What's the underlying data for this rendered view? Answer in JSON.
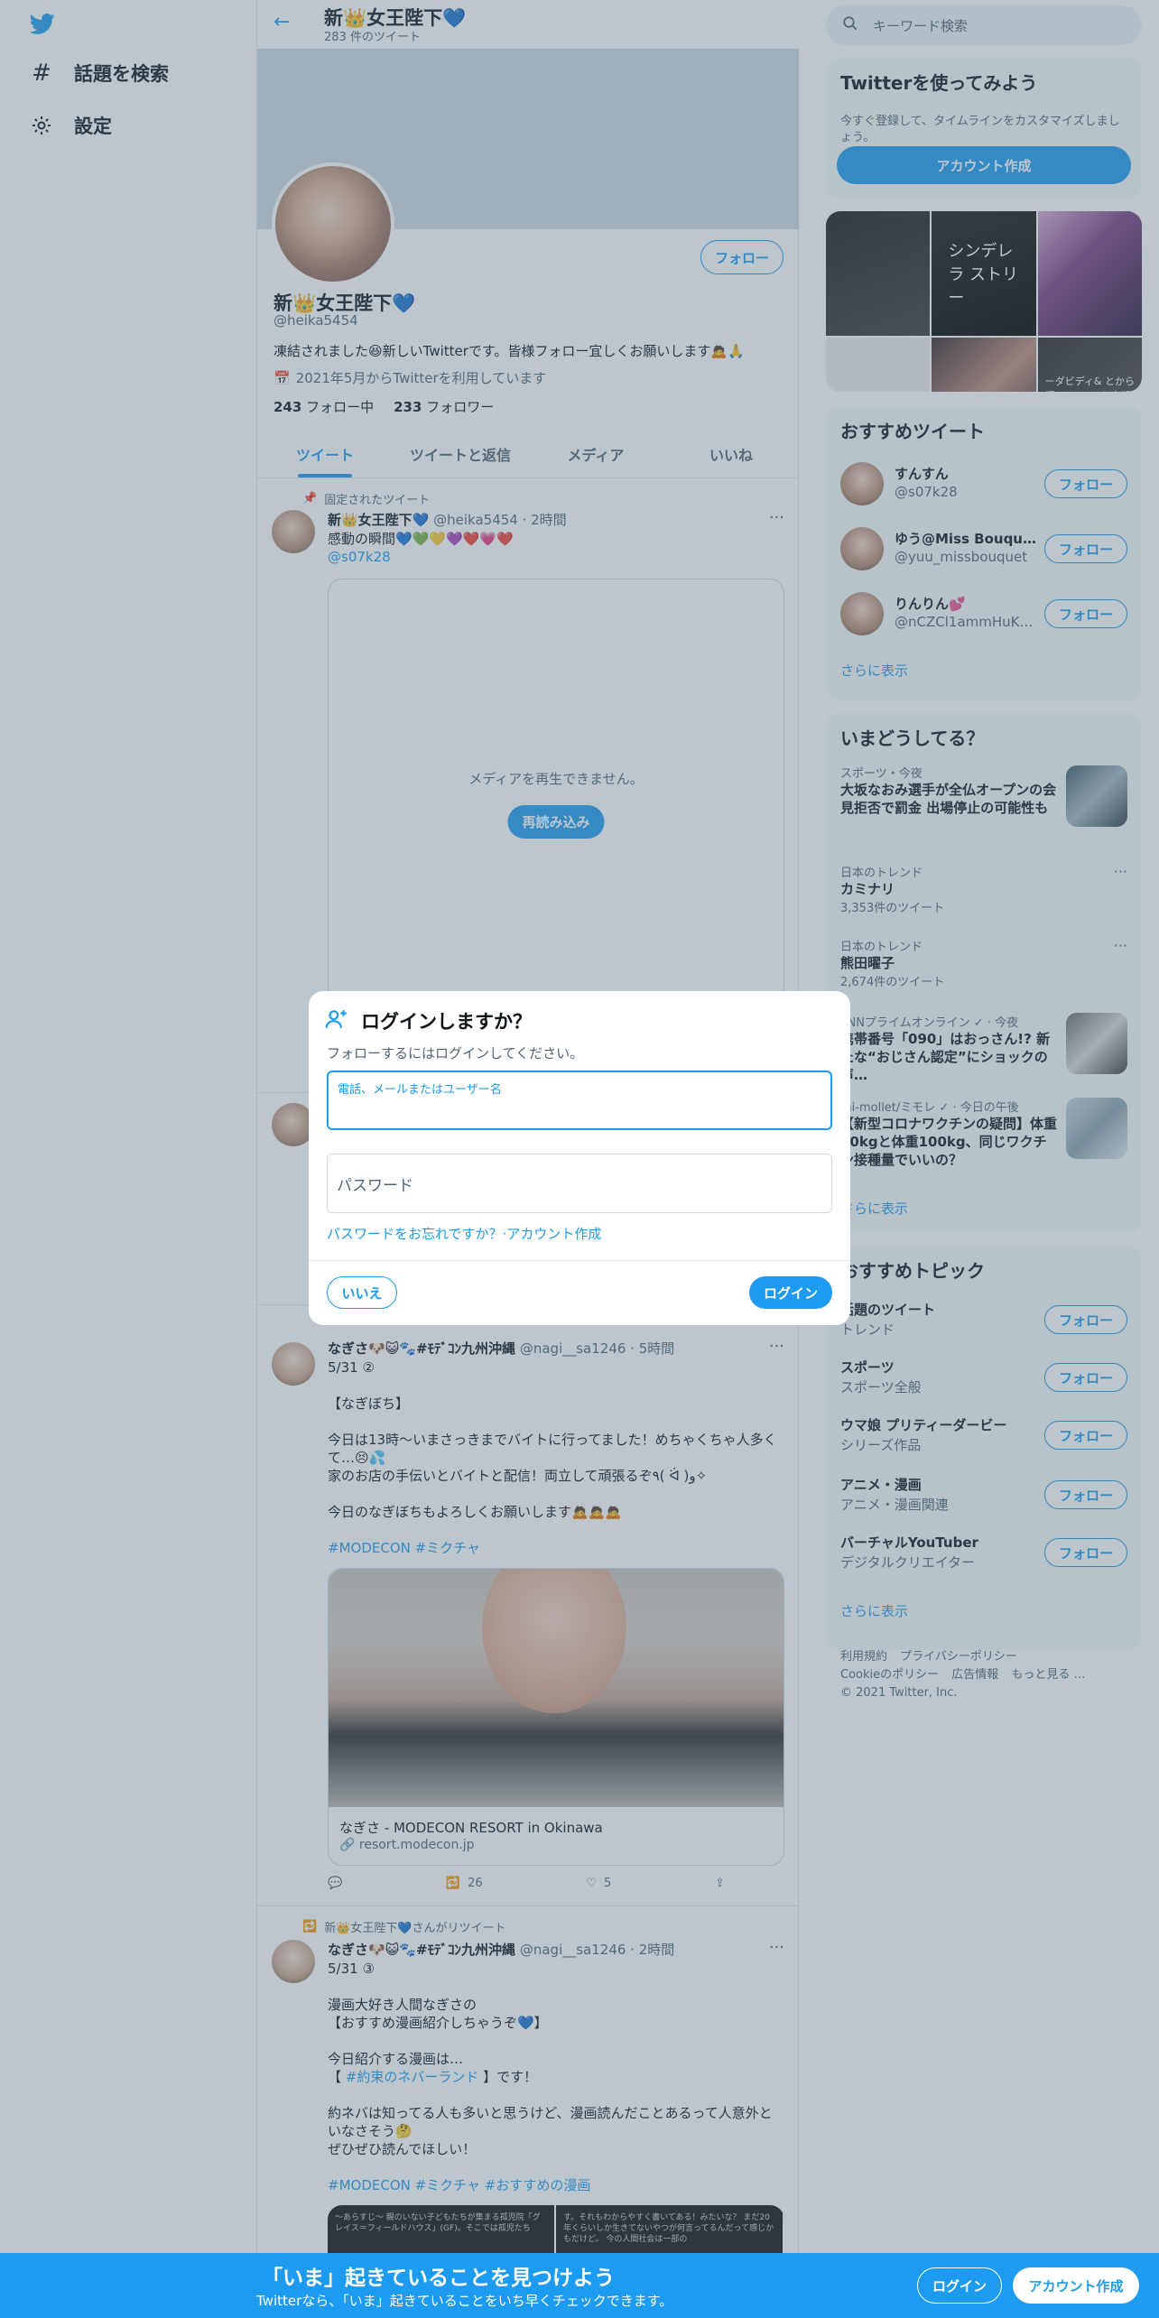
{
  "nav": {
    "items": [
      {
        "label": "話題を検索",
        "icon": "hash-icon"
      },
      {
        "label": "設定",
        "icon": "gear-icon"
      }
    ]
  },
  "header": {
    "name": "新👑女王陛下💙",
    "tweet_count": "283 件のツイート"
  },
  "profile": {
    "follow_label": "フォロー",
    "name": "新👑女王陛下💙",
    "handle": "@heika5454",
    "bio": "凍結されました😆新しいTwitterです。皆様フォロー宜しくお願いします🙇🙏",
    "joined": "2021年5月からTwitterを利用しています",
    "following_count": "243",
    "following_label": "フォロー中",
    "followers_count": "233",
    "followers_label": "フォロワー"
  },
  "tabs": [
    "ツイート",
    "ツイートと返信",
    "メディア",
    "いいね"
  ],
  "tweet1": {
    "pinned": "固定されたツイート",
    "name": "新👑女王陛下💙",
    "handle_time": "@heika5454 · 2時間",
    "text": "感動の瞬間💙💚💛💜❤️💗❤️",
    "mention": "@s07k28",
    "media_error": "メディアを再生できません。",
    "reload": "再読み込み"
  },
  "tweet3": {
    "name": "なぎさ🐶😺🐾#ﾓﾃﾞｺﾝ九州沖縄",
    "handle_time": "@nagi__sa1246 · 5時間",
    "lines": [
      "5/31 ②",
      "",
      "【なぎぼち】",
      "",
      "今日は13時〜いまさっきまでバイトに行ってました！めちゃくちゃ人多くて…😣💦",
      "家のお店の手伝いとバイトと配信！両立して頑張るぞ٩( ᐛ )و✧",
      "",
      "今日のなぎぼちもよろしくお願いします🙇🙇🙇"
    ],
    "tags": "#MODECON #ミクチャ",
    "card_title": "なぎさ - MODECON RESORT in Okinawa",
    "card_url": "resort.modecon.jp",
    "retweets": "26",
    "likes": "5"
  },
  "tweet4": {
    "context": "新👑女王陛下💙さんがリツイート",
    "name": "なぎさ🐶😺🐾#ﾓﾃﾞｺﾝ九州沖縄",
    "handle_time": "@nagi__sa1246 · 2時間",
    "lines": [
      "5/31 ③",
      "",
      "漫画大好き人間なぎさの",
      "【おすすめ漫画紹介しちゃうぞ💙】",
      "",
      "今日紹介する漫画は…"
    ],
    "line_tag_pre": "【 ",
    "line_tag": "#約束のネバーランド",
    "line_tag_post": " 】です！",
    "lines2": [
      "",
      "約ネバは知ってる人も多いと思うけど、漫画読んだことあるって人意外といなさそう🤔",
      "ぜひぜひ読んでほしい！"
    ],
    "tags": "#MODECON #ミクチャ #おすすめの漫画",
    "comic_left": "〜あらすじ〜 親のいない子どもたちが集まる孤児院「グレイス＝フィールドハウス」(GF)。そこでは孤児たち",
    "comic_right": "す。それもわからやすく書いてある！みたいな？ まだ20年くらいしか生きてないやつが何言ってるんだって感じかもだけど。 今の人間社会は一部の"
  },
  "search": {
    "placeholder": "キーワード検索"
  },
  "join": {
    "title": "Twitterを使ってみよう",
    "desc": "今すぐ登録して、タイムラインをカスタマイズしましょう。",
    "button": "アカウント作成"
  },
  "gallery": {
    "g2": "シンデレラ ストリー",
    "g6": "ーダビディ& とから揚 スイーツ を定期に 胸張情報"
  },
  "rec_tweets": {
    "title": "おすすめツイート",
    "users": [
      {
        "name": "すんすん",
        "handle": "@s07k28"
      },
      {
        "name": "ゆう@Miss Bouquet…",
        "handle": "@yuu_missbouquet"
      },
      {
        "name": "りんりん💕",
        "handle": "@nCZCl1ammHuKsps"
      }
    ],
    "follow": "フォロー",
    "more": "さらに表示"
  },
  "trends": {
    "title": "いまどうしてる？",
    "items": [
      {
        "cat": "スポーツ・今夜",
        "title": "大坂なおみ選手が全仏オープンの会見拒否で罰金 出場停止の可能性も",
        "count": ""
      },
      {
        "cat": "日本のトレンド",
        "title": "カミナリ",
        "count": "3,353件のツイート"
      },
      {
        "cat": "日本のトレンド",
        "title": "熊田曜子",
        "count": "2,674件のツイート"
      },
      {
        "cat": "FNNプライムオンライン ✓ · 今夜",
        "title": "携帯番号「090」はおっさん!? 新たな“おじさん認定”にショックの声…",
        "count": ""
      },
      {
        "cat": "mi-mollet/ミモレ ✓ · 今日の午後",
        "title": "【新型コロナワクチンの疑問】体重40kgと体重100kg、同じワクチン接種量でいいの？",
        "count": ""
      }
    ],
    "more": "さらに表示"
  },
  "topics": {
    "title": "おすすめトピック",
    "items": [
      {
        "name": "話題のツイート",
        "sub": "トレンド"
      },
      {
        "name": "スポーツ",
        "sub": "スポーツ全般"
      },
      {
        "name": "ウマ娘 プリティーダービー",
        "sub": "シリーズ作品"
      },
      {
        "name": "アニメ・漫画",
        "sub": "アニメ・漫画関連"
      },
      {
        "name": "バーチャルYouTuber",
        "sub": "デジタルクリエイター"
      }
    ],
    "follow": "フォロー",
    "more": "さらに表示"
  },
  "footer": {
    "terms": "利用規約",
    "privacy": "プライバシーポリシー",
    "cookie": "Cookieのポリシー",
    "ads": "広告情報",
    "more": "もっと見る …",
    "copyright": "© 2021 Twitter, Inc."
  },
  "modal": {
    "title": "ログインしますか？",
    "subtitle": "フォローするにはログインしてください。",
    "user_label": "電話、メールまたはユーザー名",
    "password_placeholder": "パスワード",
    "forgot": "パスワードをお忘れですか？",
    "sep": "·",
    "signup": "アカウント作成",
    "no": "いいえ",
    "login": "ログイン"
  },
  "bottom": {
    "title": "「いま」起きていることを見つけよう",
    "subtitle": "Twitterなら、「いま」起きていることをいち早くチェックできます。",
    "login": "ログイン",
    "signup": "アカウント作成"
  },
  "colors": {
    "accent": "#1d9bf0",
    "overlay": "rgba(91,112,131,0.4)"
  }
}
